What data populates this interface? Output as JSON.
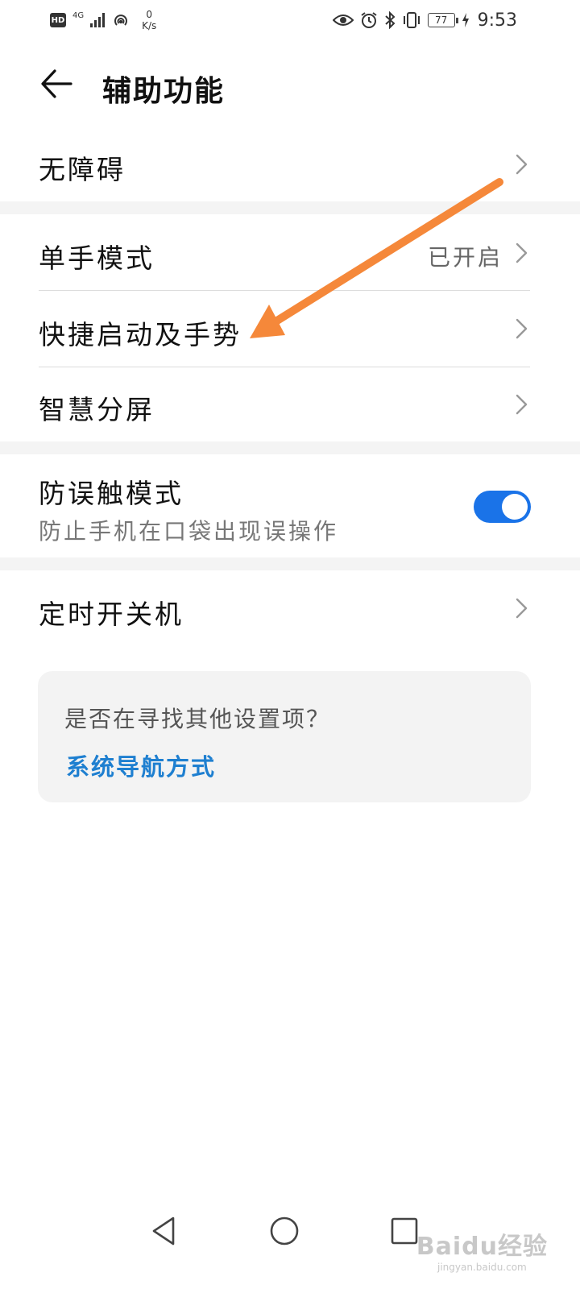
{
  "status_bar": {
    "hd": "HD",
    "network": "4G",
    "speed_value": "0",
    "speed_unit": "K/s",
    "battery": "77",
    "time": "9:53",
    "icons": [
      "hd-icon",
      "signal-icon",
      "hotspot-icon",
      "eye-icon",
      "alarm-icon",
      "bluetooth-icon",
      "vibrate-icon",
      "battery-icon",
      "charging-icon"
    ]
  },
  "header": {
    "title": "辅助功能",
    "back_icon": "back-arrow-icon"
  },
  "settings": {
    "accessibility": {
      "label": "无障碍"
    },
    "one_hand_mode": {
      "label": "单手模式",
      "value": "已开启"
    },
    "quick_launch": {
      "label": "快捷启动及手势"
    },
    "smart_split": {
      "label": "智慧分屏"
    },
    "pocket_mode": {
      "label": "防误触模式",
      "subtitle": "防止手机在口袋出现误操作",
      "enabled": true
    },
    "scheduled_power": {
      "label": "定时开关机"
    }
  },
  "hint_card": {
    "question": "是否在寻找其他设置项？",
    "link": "系统导航方式"
  },
  "annotation": {
    "color": "#f5883a"
  },
  "colors": {
    "accent": "#1a73e8",
    "link": "#1e7fd0"
  },
  "watermark": {
    "main": "Baidu经验",
    "sub": "jingyan.baidu.com"
  },
  "nav_bar": {
    "icons": [
      "back-triangle-icon",
      "home-circle-icon",
      "recents-square-icon"
    ]
  }
}
